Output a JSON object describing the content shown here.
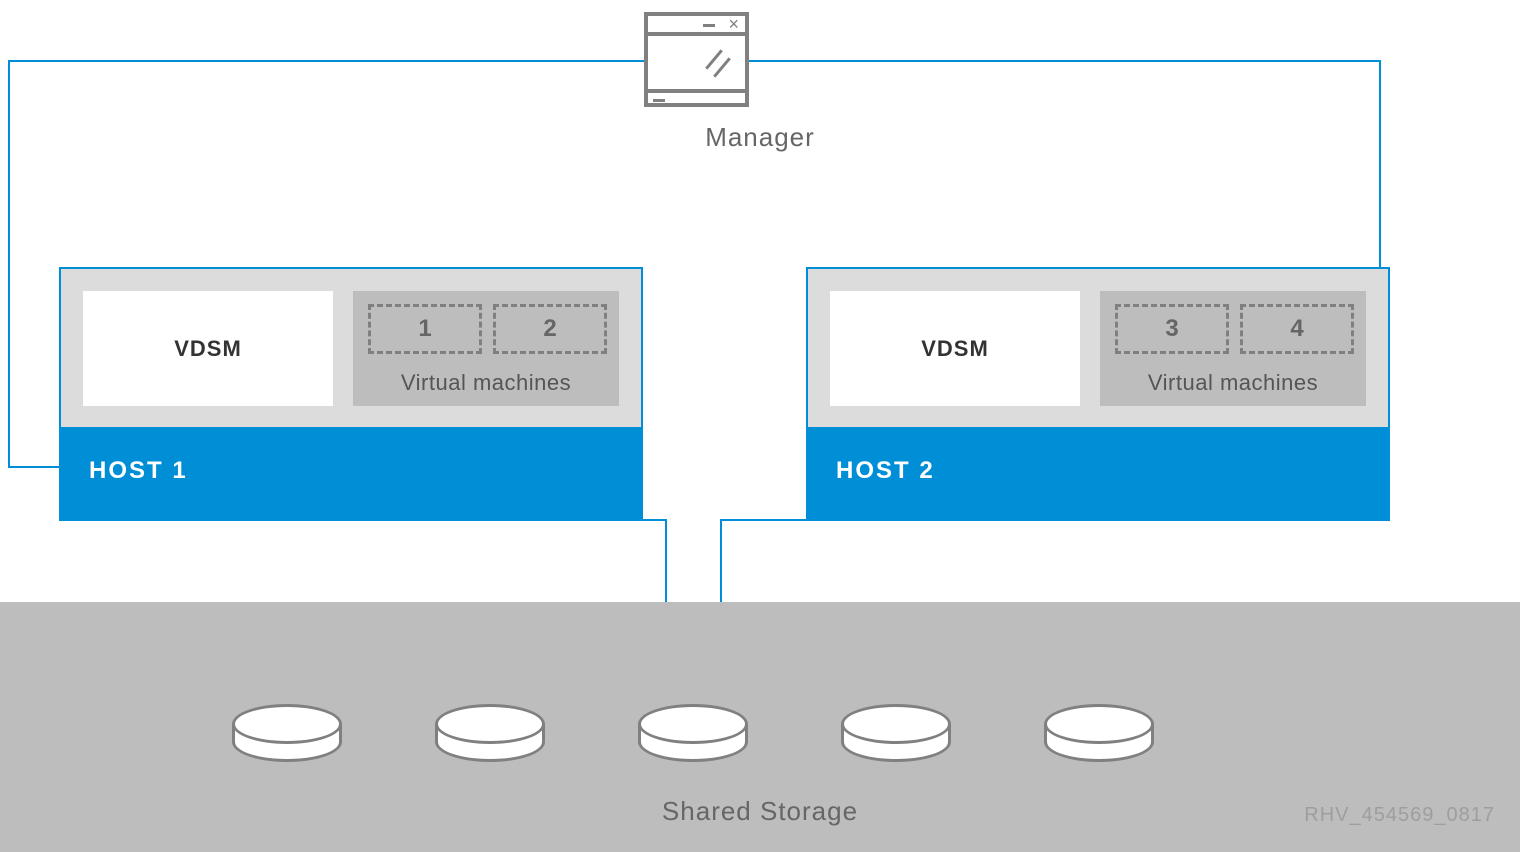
{
  "manager": {
    "label": "Manager"
  },
  "hosts": [
    {
      "title": "HOST 1",
      "agent": "VDSM",
      "vm_section_label": "Virtual machines",
      "vm_ids": [
        "1",
        "2"
      ]
    },
    {
      "title": "HOST 2",
      "agent": "VDSM",
      "vm_section_label": "Virtual machines",
      "vm_ids": [
        "3",
        "4"
      ]
    }
  ],
  "storage": {
    "label": "Shared Storage",
    "disk_count": 5
  },
  "footprint": "RHV_454569_0817",
  "colors": {
    "accent": "#008fd6",
    "grey_panel": "#bdbdbd",
    "grey_light": "#dcdcdc",
    "outline": "#808080"
  }
}
